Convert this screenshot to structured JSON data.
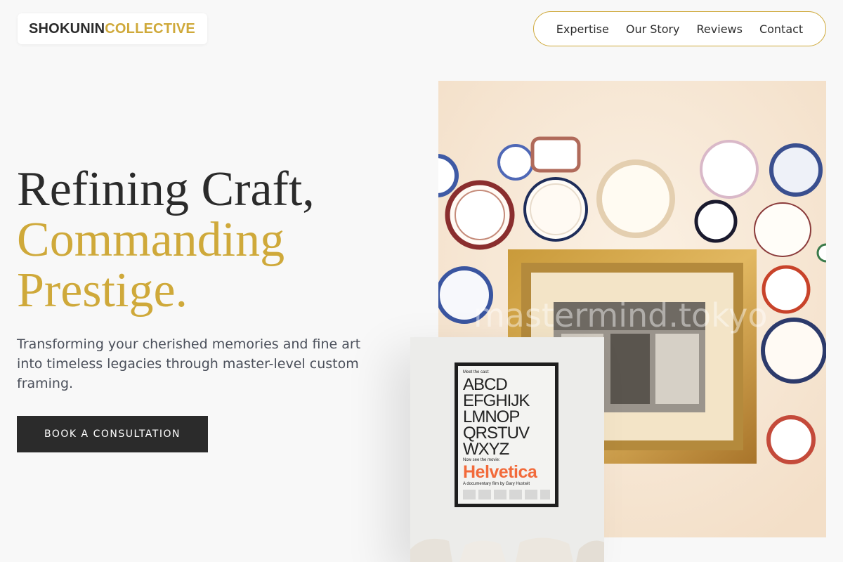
{
  "brand": {
    "part1": "SHOKUNIN",
    "part2": "COLLECTIVE"
  },
  "nav": {
    "items": [
      "Expertise",
      "Our Story",
      "Reviews",
      "Contact"
    ]
  },
  "hero": {
    "title_line1": "Refining Craft,",
    "title_line2": "Commanding",
    "title_line3": "Prestige.",
    "subtitle": "Transforming your cherished memories and fine art into timeless legacies through master-level custom framing.",
    "cta_label": "BOOK A CONSULTATION"
  },
  "images": {
    "main_watermark": "mastermind.tokyo",
    "poster": {
      "top": "Meet the cast:",
      "alphabet": "ABCD\nEFGHIJK\nLMNOP\nQRSTUV\nWXYZ",
      "mid": "Now see the movie:",
      "title": "Helvetica",
      "bottom": "A documentary film by Gary Hustwit"
    }
  },
  "colors": {
    "accent": "#cfa93a",
    "dark": "#2b2b2b",
    "background": "#f8f8f8"
  }
}
